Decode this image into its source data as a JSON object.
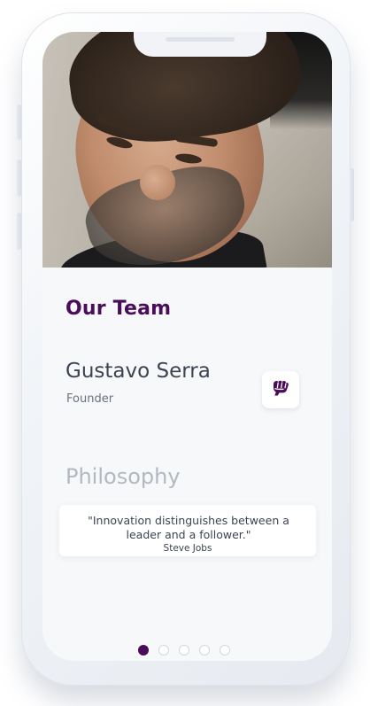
{
  "team": {
    "section_title": "Our Team",
    "member_name": "Gustavo Serra",
    "member_role": "Founder"
  },
  "philosophy": {
    "heading": "Philosophy",
    "quote": "\"Innovation distinguishes between a leader and a follower.\"",
    "author": "Steve Jobs"
  },
  "pagination": {
    "total": 5,
    "active_index": 0
  },
  "colors": {
    "brand_purple": "#4a0d5a",
    "text_dark": "#3c4452",
    "text_muted": "#b3b8c1"
  },
  "icons": {
    "logo": "fist-logo-icon"
  }
}
